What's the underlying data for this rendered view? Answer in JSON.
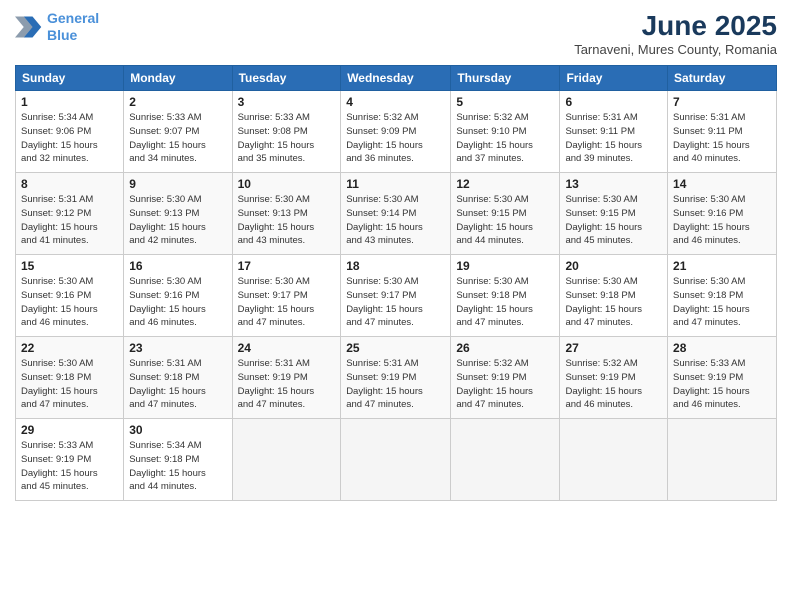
{
  "logo": {
    "line1": "General",
    "line2": "Blue"
  },
  "title": "June 2025",
  "location": "Tarnaveni, Mures County, Romania",
  "weekdays": [
    "Sunday",
    "Monday",
    "Tuesday",
    "Wednesday",
    "Thursday",
    "Friday",
    "Saturday"
  ],
  "weeks": [
    [
      {
        "day": "1",
        "info": "Sunrise: 5:34 AM\nSunset: 9:06 PM\nDaylight: 15 hours\nand 32 minutes."
      },
      {
        "day": "2",
        "info": "Sunrise: 5:33 AM\nSunset: 9:07 PM\nDaylight: 15 hours\nand 34 minutes."
      },
      {
        "day": "3",
        "info": "Sunrise: 5:33 AM\nSunset: 9:08 PM\nDaylight: 15 hours\nand 35 minutes."
      },
      {
        "day": "4",
        "info": "Sunrise: 5:32 AM\nSunset: 9:09 PM\nDaylight: 15 hours\nand 36 minutes."
      },
      {
        "day": "5",
        "info": "Sunrise: 5:32 AM\nSunset: 9:10 PM\nDaylight: 15 hours\nand 37 minutes."
      },
      {
        "day": "6",
        "info": "Sunrise: 5:31 AM\nSunset: 9:11 PM\nDaylight: 15 hours\nand 39 minutes."
      },
      {
        "day": "7",
        "info": "Sunrise: 5:31 AM\nSunset: 9:11 PM\nDaylight: 15 hours\nand 40 minutes."
      }
    ],
    [
      {
        "day": "8",
        "info": "Sunrise: 5:31 AM\nSunset: 9:12 PM\nDaylight: 15 hours\nand 41 minutes."
      },
      {
        "day": "9",
        "info": "Sunrise: 5:30 AM\nSunset: 9:13 PM\nDaylight: 15 hours\nand 42 minutes."
      },
      {
        "day": "10",
        "info": "Sunrise: 5:30 AM\nSunset: 9:13 PM\nDaylight: 15 hours\nand 43 minutes."
      },
      {
        "day": "11",
        "info": "Sunrise: 5:30 AM\nSunset: 9:14 PM\nDaylight: 15 hours\nand 43 minutes."
      },
      {
        "day": "12",
        "info": "Sunrise: 5:30 AM\nSunset: 9:15 PM\nDaylight: 15 hours\nand 44 minutes."
      },
      {
        "day": "13",
        "info": "Sunrise: 5:30 AM\nSunset: 9:15 PM\nDaylight: 15 hours\nand 45 minutes."
      },
      {
        "day": "14",
        "info": "Sunrise: 5:30 AM\nSunset: 9:16 PM\nDaylight: 15 hours\nand 46 minutes."
      }
    ],
    [
      {
        "day": "15",
        "info": "Sunrise: 5:30 AM\nSunset: 9:16 PM\nDaylight: 15 hours\nand 46 minutes."
      },
      {
        "day": "16",
        "info": "Sunrise: 5:30 AM\nSunset: 9:16 PM\nDaylight: 15 hours\nand 46 minutes."
      },
      {
        "day": "17",
        "info": "Sunrise: 5:30 AM\nSunset: 9:17 PM\nDaylight: 15 hours\nand 47 minutes."
      },
      {
        "day": "18",
        "info": "Sunrise: 5:30 AM\nSunset: 9:17 PM\nDaylight: 15 hours\nand 47 minutes."
      },
      {
        "day": "19",
        "info": "Sunrise: 5:30 AM\nSunset: 9:18 PM\nDaylight: 15 hours\nand 47 minutes."
      },
      {
        "day": "20",
        "info": "Sunrise: 5:30 AM\nSunset: 9:18 PM\nDaylight: 15 hours\nand 47 minutes."
      },
      {
        "day": "21",
        "info": "Sunrise: 5:30 AM\nSunset: 9:18 PM\nDaylight: 15 hours\nand 47 minutes."
      }
    ],
    [
      {
        "day": "22",
        "info": "Sunrise: 5:30 AM\nSunset: 9:18 PM\nDaylight: 15 hours\nand 47 minutes."
      },
      {
        "day": "23",
        "info": "Sunrise: 5:31 AM\nSunset: 9:18 PM\nDaylight: 15 hours\nand 47 minutes."
      },
      {
        "day": "24",
        "info": "Sunrise: 5:31 AM\nSunset: 9:19 PM\nDaylight: 15 hours\nand 47 minutes."
      },
      {
        "day": "25",
        "info": "Sunrise: 5:31 AM\nSunset: 9:19 PM\nDaylight: 15 hours\nand 47 minutes."
      },
      {
        "day": "26",
        "info": "Sunrise: 5:32 AM\nSunset: 9:19 PM\nDaylight: 15 hours\nand 47 minutes."
      },
      {
        "day": "27",
        "info": "Sunrise: 5:32 AM\nSunset: 9:19 PM\nDaylight: 15 hours\nand 46 minutes."
      },
      {
        "day": "28",
        "info": "Sunrise: 5:33 AM\nSunset: 9:19 PM\nDaylight: 15 hours\nand 46 minutes."
      }
    ],
    [
      {
        "day": "29",
        "info": "Sunrise: 5:33 AM\nSunset: 9:19 PM\nDaylight: 15 hours\nand 45 minutes."
      },
      {
        "day": "30",
        "info": "Sunrise: 5:34 AM\nSunset: 9:18 PM\nDaylight: 15 hours\nand 44 minutes."
      },
      {
        "day": "",
        "info": ""
      },
      {
        "day": "",
        "info": ""
      },
      {
        "day": "",
        "info": ""
      },
      {
        "day": "",
        "info": ""
      },
      {
        "day": "",
        "info": ""
      }
    ]
  ]
}
